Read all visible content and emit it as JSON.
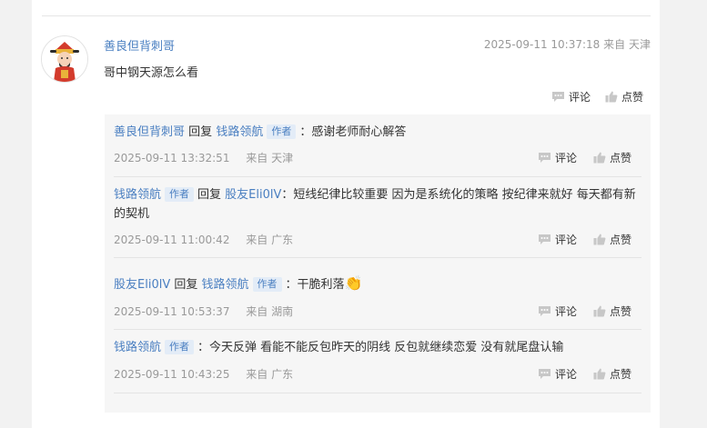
{
  "comment": {
    "author": "善良但背刺哥",
    "time": "2025-09-11 10:37:18",
    "from_label": "来自",
    "location": "天津",
    "text": "哥中钢天源怎么看",
    "comment_label": "评论",
    "like_label": "点赞"
  },
  "replies": [
    {
      "from_user": "善良但背刺哥",
      "reply_word": "回复",
      "to_user": "钱路领航",
      "to_badge": "作者",
      "text": "：感谢老师耐心解答",
      "time": "2025-09-11 13:32:51",
      "from_label": "来自",
      "location": "天津",
      "comment_label": "评论",
      "like_label": "点赞"
    },
    {
      "from_user": "钱路领航",
      "from_badge": "作者",
      "reply_word": "回复",
      "to_user": "股友Eli0lV",
      "text": "：短线纪律比较重要 因为是系统化的策略 按纪律来就好 每天都有新的契机",
      "time": "2025-09-11 11:00:42",
      "from_label": "来自",
      "location": "广东",
      "comment_label": "评论",
      "like_label": "点赞"
    },
    {
      "from_user": "股友Eli0lV",
      "reply_word": "回复",
      "to_user": "钱路领航",
      "to_badge": "作者",
      "text": "：干脆利落",
      "emoji": "👏",
      "time": "2025-09-11 10:53:37",
      "from_label": "来自",
      "location": "湖南",
      "comment_label": "评论",
      "like_label": "点赞"
    },
    {
      "from_user": "钱路领航",
      "from_badge": "作者",
      "text": "：今天反弹 看能不能反包昨天的阴线 反包就继续恋爱 没有就尾盘认输",
      "time": "2025-09-11 10:43:25",
      "from_label": "来自",
      "location": "广东",
      "comment_label": "评论",
      "like_label": "点赞"
    }
  ],
  "colors": {
    "link": "#4a7fc1",
    "badge_bg": "#e3ecf7",
    "meta": "#999999",
    "reply_bg": "#f6f6f6"
  }
}
